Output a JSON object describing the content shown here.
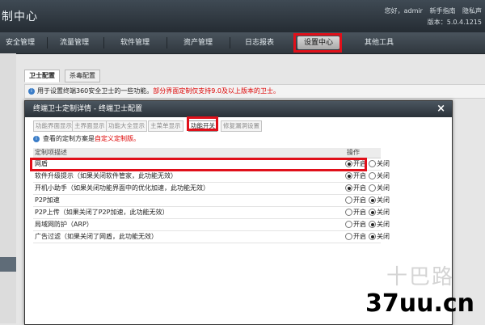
{
  "header": {
    "title": "制中心",
    "greeting": "您好，admir",
    "links": [
      "新手指南",
      "隐私声"
    ],
    "version": "版本：5.0.4.1215"
  },
  "nav": {
    "items": [
      "安全管理",
      "流量管理",
      "软件管理",
      "资产管理",
      "日志报表",
      "设置中心",
      "其他工具"
    ],
    "active_index": 5
  },
  "subtabs": [
    "卫士配置",
    "杀毒配置"
  ],
  "infobar": {
    "text": "用于设置终端360安全卫士的一些功能。",
    "warning": "部分界面定制仅支持9.0及以上版本的卫士。"
  },
  "modal": {
    "title": "终端卫士定制详情 - 终端卫士配置",
    "close_label": "×",
    "tabs": [
      "功能界面显示",
      "主界面显示",
      "功能大全显示",
      "主菜单显示",
      "功能开关",
      "修复漏洞设置"
    ],
    "active_tab": 4,
    "info_prefix": "查看的定制方案是",
    "info_plan": "自定义定制版。",
    "table": {
      "col_desc": "定制项描述",
      "col_op": "操作",
      "on_label": "开启",
      "off_label": "关闭",
      "rows": [
        {
          "label": "网盾",
          "on": true
        },
        {
          "label": "软件升级提示（如果关闭软件管家，此功能无效）",
          "on": true
        },
        {
          "label": "开机小助手（如果关闭功能界面中的优化加速，此功能无效）",
          "on": true
        },
        {
          "label": "P2P加速",
          "on": false
        },
        {
          "label": "P2P上传（如果关闭了P2P加速，此功能无效）",
          "on": false
        },
        {
          "label": "局域网防护（ARP）",
          "on": false
        },
        {
          "label": "广告过滤（如果关闭了网盾，此功能无效）",
          "on": false
        }
      ]
    }
  },
  "watermark": {
    "line1": "十巴路",
    "line2": "37uu.cn"
  },
  "colors": {
    "highlight": "#e0101a",
    "header_dark": "#252c33",
    "warning_text": "#dd0000",
    "info_icon": "#3a7cc7"
  },
  "icons": {
    "info": "info-icon",
    "close": "close-icon",
    "radio": "radio-icon"
  }
}
